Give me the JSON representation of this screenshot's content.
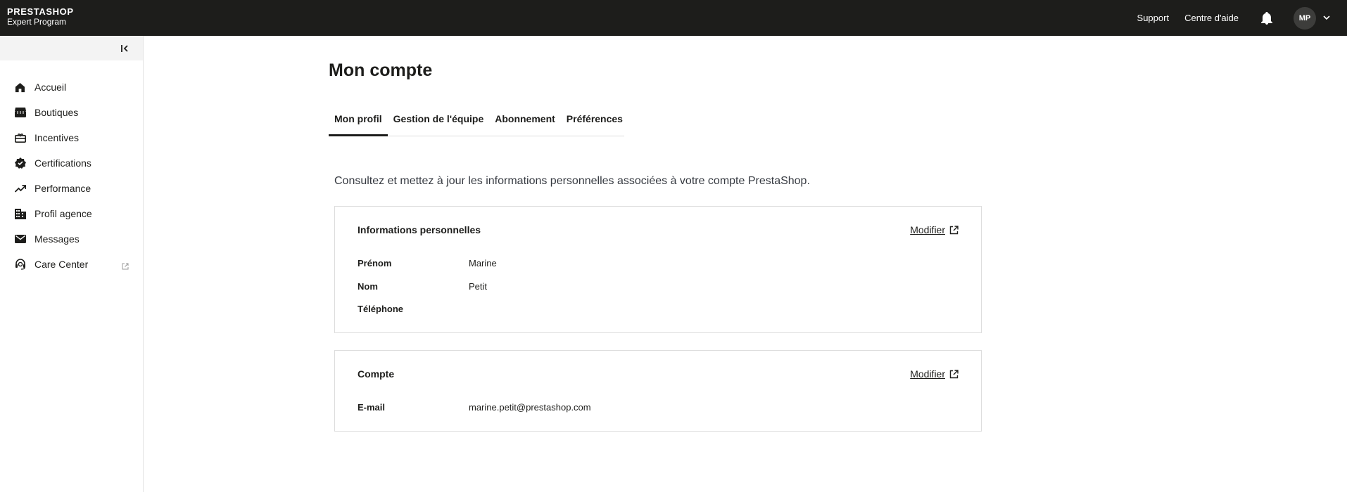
{
  "header": {
    "brand_name": "PRESTASHOP",
    "brand_subtitle": "Expert Program",
    "links": [
      "Support",
      "Centre d'aide"
    ],
    "avatar_initials": "MP"
  },
  "sidebar": {
    "items": [
      {
        "label": "Accueil",
        "icon": "home-icon"
      },
      {
        "label": "Boutiques",
        "icon": "store-icon"
      },
      {
        "label": "Incentives",
        "icon": "gift-icon"
      },
      {
        "label": "Certifications",
        "icon": "verified-badge-icon"
      },
      {
        "label": "Performance",
        "icon": "trending-up-icon"
      },
      {
        "label": "Profil agence",
        "icon": "building-icon"
      },
      {
        "label": "Messages",
        "icon": "mail-icon"
      },
      {
        "label": "Care Center",
        "icon": "support-agent-icon",
        "external": true
      }
    ]
  },
  "main": {
    "title": "Mon compte",
    "tabs": [
      "Mon profil",
      "Gestion de l'équipe",
      "Abonnement",
      "Préférences"
    ],
    "active_tab": "Mon profil",
    "intro": "Consultez et mettez à jour les informations personnelles associées à votre compte PrestaShop.",
    "personal_card": {
      "title": "Informations personnelles",
      "edit_label": "Modifier",
      "rows": [
        {
          "label": "Prénom",
          "value": "Marine"
        },
        {
          "label": "Nom",
          "value": "Petit"
        },
        {
          "label": "Téléphone",
          "value": ""
        }
      ]
    },
    "account_card": {
      "title": "Compte",
      "edit_label": "Modifier",
      "rows": [
        {
          "label": "E-mail",
          "value": "marine.petit@prestashop.com"
        }
      ]
    }
  }
}
